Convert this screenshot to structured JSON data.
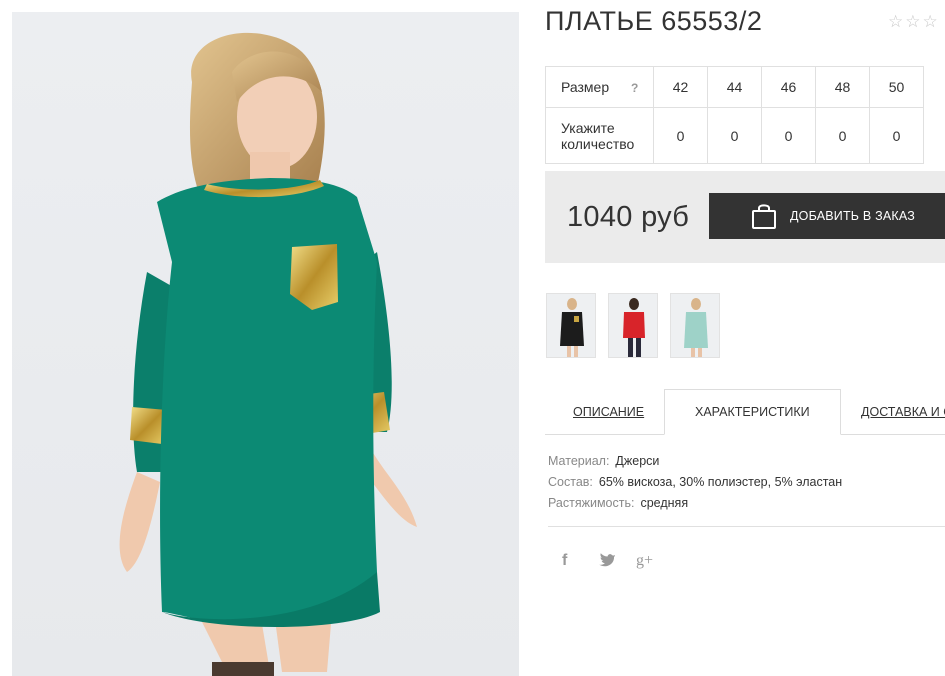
{
  "product": {
    "title": "ПЛАТЬЕ 65553/2",
    "rating_stars": 5,
    "rating_value": 0
  },
  "sizes_table": {
    "size_label": "Размер",
    "help_label": "?",
    "qty_label": "Укажите количество",
    "sizes": [
      "42",
      "44",
      "46",
      "48",
      "50"
    ],
    "quantities": [
      "0",
      "0",
      "0",
      "0",
      "0"
    ]
  },
  "price_box": {
    "price": "1040 руб",
    "add_button": "ДОБАВИТЬ В ЗАКАЗ",
    "button_icon": "shopping-bag-icon"
  },
  "color_variants": [
    {
      "name": "black",
      "dress_color": "#1c1c1c"
    },
    {
      "name": "red",
      "dress_color": "#d8242a"
    },
    {
      "name": "mint",
      "dress_color": "#9ed2c8"
    }
  ],
  "tabs": {
    "description": "ОПИСАНИЕ",
    "characteristics": "ХАРАКТЕРИСТИКИ",
    "delivery": "ДОСТАВКА И С"
  },
  "specs": {
    "material_key": "Материал:",
    "material_value": "Джерси",
    "composition_key": "Состав:",
    "composition_value": "65% вискоза, 30% полиэстер, 5% эластан",
    "stretch_key": "Растяжимость:",
    "stretch_value": "средняя"
  },
  "social": {
    "facebook": "f",
    "twitter": "twitter-bird-icon",
    "googleplus": "g+"
  },
  "colors": {
    "dress": "#0c8a74",
    "gold": "#c9a642",
    "button": "#333333",
    "price_bg": "#ebebeb"
  }
}
